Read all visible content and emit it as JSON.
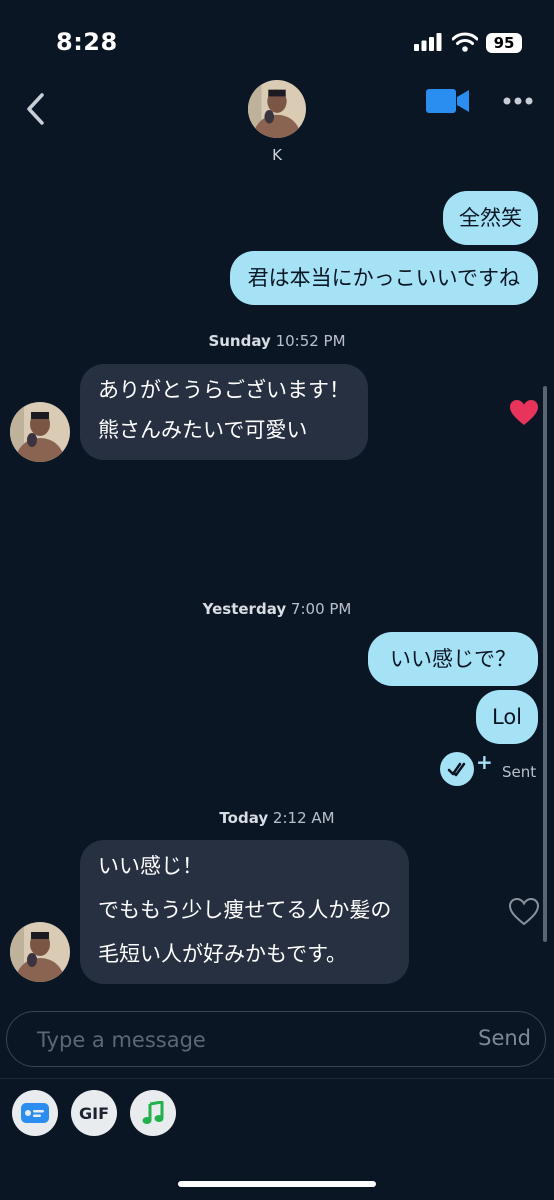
{
  "status_bar": {
    "time": "8:28",
    "battery": "95"
  },
  "header": {
    "contact_name": "K"
  },
  "messages": {
    "m1": "全然笑",
    "m2": "君は本当にかっこいいですね",
    "m3_line1": "ありがとうらございます！",
    "m3_line2": "熊さんみたいで可愛い",
    "m4": "いい感じで？",
    "m5": "Lol",
    "m6_line1": "いい感じ！",
    "m6_line2": "でももう少し痩せてる人か髪の",
    "m6_line3": "毛短い人が好みかもです。"
  },
  "timestamps": {
    "t1_day": "Sunday",
    "t1_time": "10:52 PM",
    "t2_day": "Yesterday",
    "t2_time": "7:00 PM",
    "t3_day": "Today",
    "t3_time": "2:12 AM"
  },
  "receipt": {
    "status": "Sent"
  },
  "composer": {
    "placeholder": "Type a message",
    "send_label": "Send"
  },
  "tools": {
    "gif_label": "GIF"
  },
  "colors": {
    "sent_bubble": "#a6e2f6",
    "received_bubble": "#263040",
    "background": "#0b1624",
    "like": "#e8345a",
    "video_icon": "#2a8df0"
  },
  "icons": [
    "back-chevron-icon",
    "video-call-icon",
    "more-options-icon",
    "heart-filled-icon",
    "heart-outline-icon",
    "read-receipt-icon",
    "sticker-card-icon",
    "music-note-icon"
  ]
}
